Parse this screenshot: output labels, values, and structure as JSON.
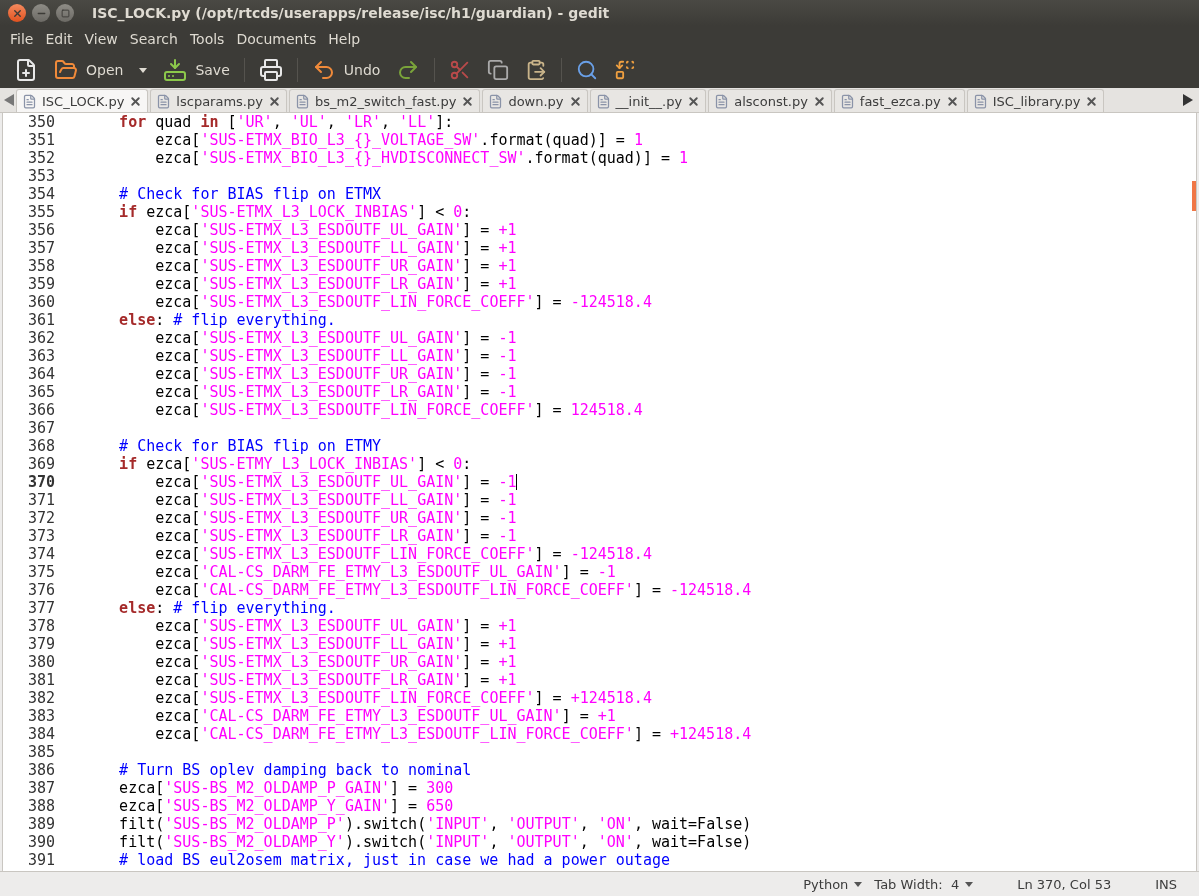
{
  "window": {
    "title": "ISC_LOCK.py (/opt/rtcds/userapps/release/isc/h1/guardian) - gedit"
  },
  "menu": [
    "File",
    "Edit",
    "View",
    "Search",
    "Tools",
    "Documents",
    "Help"
  ],
  "toolbar": {
    "open_label": "Open",
    "save_label": "Save",
    "undo_label": "Undo"
  },
  "tabs": [
    {
      "label": "ISC_LOCK.py",
      "selected": true
    },
    {
      "label": "lscparams.py",
      "selected": false
    },
    {
      "label": "bs_m2_switch_fast.py",
      "selected": false
    },
    {
      "label": "down.py",
      "selected": false
    },
    {
      "label": "__init__.py",
      "selected": false
    },
    {
      "label": "alsconst.py",
      "selected": false
    },
    {
      "label": "fast_ezca.py",
      "selected": false
    },
    {
      "label": "ISC_library.py",
      "selected": false
    }
  ],
  "editor": {
    "lines": [
      {
        "number": "350",
        "current": false,
        "kind": "block",
        "tokens": [
          {
            "kind": "keyword",
            "text": "for"
          },
          {
            "kind": "plain",
            "text": " quad "
          },
          {
            "kind": "keyword",
            "text": "in"
          },
          {
            "kind": "plain",
            "text": " ["
          },
          {
            "kind": "string",
            "text": "'UR'"
          },
          {
            "kind": "plain",
            "text": ", "
          },
          {
            "kind": "string",
            "text": "'UL'"
          },
          {
            "kind": "plain",
            "text": ", "
          },
          {
            "kind": "string",
            "text": "'LR'"
          },
          {
            "kind": "plain",
            "text": ", "
          },
          {
            "kind": "string",
            "text": "'LL'"
          },
          {
            "kind": "plain",
            "text": "]:"
          }
        ]
      },
      {
        "number": "351",
        "current": false,
        "kind": "nested",
        "tokens": [
          {
            "kind": "plain",
            "text": "ezca["
          },
          {
            "kind": "string",
            "text": "'SUS-ETMX_BIO_L3_{}_VOLTAGE_SW'"
          },
          {
            "kind": "plain",
            "text": ".format(quad)] = "
          },
          {
            "kind": "number",
            "text": "1"
          }
        ]
      },
      {
        "number": "352",
        "current": false,
        "kind": "nested",
        "tokens": [
          {
            "kind": "plain",
            "text": "ezca["
          },
          {
            "kind": "string",
            "text": "'SUS-ETMX_BIO_L3_{}_HVDISCONNECT_SW'"
          },
          {
            "kind": "plain",
            "text": ".format(quad)] = "
          },
          {
            "kind": "number",
            "text": "1"
          }
        ]
      },
      {
        "number": "353",
        "current": false
      },
      {
        "number": "354",
        "current": false,
        "kind": "block",
        "tokens": [
          {
            "kind": "comment",
            "text": "# Check for BIAS flip on ETMX"
          }
        ]
      },
      {
        "number": "355",
        "current": false,
        "kind": "block",
        "tokens": [
          {
            "kind": "keyword",
            "text": "if"
          },
          {
            "kind": "plain",
            "text": " ezca["
          },
          {
            "kind": "string",
            "text": "'SUS-ETMX_L3_LOCK_INBIAS'"
          },
          {
            "kind": "plain",
            "text": "] < "
          },
          {
            "kind": "number",
            "text": "0"
          },
          {
            "kind": "plain",
            "text": ":"
          }
        ]
      },
      {
        "number": "356",
        "current": false,
        "kind": "nested",
        "tokens": [
          {
            "kind": "plain",
            "text": "ezca["
          },
          {
            "kind": "string",
            "text": "'SUS-ETMX_L3_ESDOUTF_UL_GAIN'"
          },
          {
            "kind": "plain",
            "text": "] = "
          },
          {
            "kind": "number",
            "text": "+1"
          }
        ]
      },
      {
        "number": "357",
        "current": false,
        "kind": "nested",
        "tokens": [
          {
            "kind": "plain",
            "text": "ezca["
          },
          {
            "kind": "string",
            "text": "'SUS-ETMX_L3_ESDOUTF_LL_GAIN'"
          },
          {
            "kind": "plain",
            "text": "] = "
          },
          {
            "kind": "number",
            "text": "+1"
          }
        ]
      },
      {
        "number": "358",
        "current": false,
        "kind": "nested",
        "tokens": [
          {
            "kind": "plain",
            "text": "ezca["
          },
          {
            "kind": "string",
            "text": "'SUS-ETMX_L3_ESDOUTF_UR_GAIN'"
          },
          {
            "kind": "plain",
            "text": "] = "
          },
          {
            "kind": "number",
            "text": "+1"
          }
        ]
      },
      {
        "number": "359",
        "current": false,
        "kind": "nested",
        "tokens": [
          {
            "kind": "plain",
            "text": "ezca["
          },
          {
            "kind": "string",
            "text": "'SUS-ETMX_L3_ESDOUTF_LR_GAIN'"
          },
          {
            "kind": "plain",
            "text": "] = "
          },
          {
            "kind": "number",
            "text": "+1"
          }
        ]
      },
      {
        "number": "360",
        "current": false,
        "kind": "nested",
        "tokens": [
          {
            "kind": "plain",
            "text": "ezca["
          },
          {
            "kind": "string",
            "text": "'SUS-ETMX_L3_ESDOUTF_LIN_FORCE_COEFF'"
          },
          {
            "kind": "plain",
            "text": "] = "
          },
          {
            "kind": "number",
            "text": "-124518.4"
          }
        ]
      },
      {
        "number": "361",
        "current": false,
        "kind": "block",
        "tokens": [
          {
            "kind": "keyword",
            "text": "else"
          },
          {
            "kind": "plain",
            "text": ": "
          },
          {
            "kind": "comment",
            "text": "# flip everything."
          }
        ]
      },
      {
        "number": "362",
        "current": false,
        "kind": "nested",
        "tokens": [
          {
            "kind": "plain",
            "text": "ezca["
          },
          {
            "kind": "string",
            "text": "'SUS-ETMX_L3_ESDOUTF_UL_GAIN'"
          },
          {
            "kind": "plain",
            "text": "] = "
          },
          {
            "kind": "number",
            "text": "-1"
          }
        ]
      },
      {
        "number": "363",
        "current": false,
        "kind": "nested",
        "tokens": [
          {
            "kind": "plain",
            "text": "ezca["
          },
          {
            "kind": "string",
            "text": "'SUS-ETMX_L3_ESDOUTF_LL_GAIN'"
          },
          {
            "kind": "plain",
            "text": "] = "
          },
          {
            "kind": "number",
            "text": "-1"
          }
        ]
      },
      {
        "number": "364",
        "current": false,
        "kind": "nested",
        "tokens": [
          {
            "kind": "plain",
            "text": "ezca["
          },
          {
            "kind": "string",
            "text": "'SUS-ETMX_L3_ESDOUTF_UR_GAIN'"
          },
          {
            "kind": "plain",
            "text": "] = "
          },
          {
            "kind": "number",
            "text": "-1"
          }
        ]
      },
      {
        "number": "365",
        "current": false,
        "kind": "nested",
        "tokens": [
          {
            "kind": "plain",
            "text": "ezca["
          },
          {
            "kind": "string",
            "text": "'SUS-ETMX_L3_ESDOUTF_LR_GAIN'"
          },
          {
            "kind": "plain",
            "text": "] = "
          },
          {
            "kind": "number",
            "text": "-1"
          }
        ]
      },
      {
        "number": "366",
        "current": false,
        "kind": "nested",
        "tokens": [
          {
            "kind": "plain",
            "text": "ezca["
          },
          {
            "kind": "string",
            "text": "'SUS-ETMX_L3_ESDOUTF_LIN_FORCE_COEFF'"
          },
          {
            "kind": "plain",
            "text": "] = "
          },
          {
            "kind": "number",
            "text": "124518.4"
          }
        ]
      },
      {
        "number": "367",
        "current": false
      },
      {
        "number": "368",
        "current": false,
        "kind": "block",
        "tokens": [
          {
            "kind": "comment",
            "text": "# Check for BIAS flip on ETMY"
          }
        ]
      },
      {
        "number": "369",
        "current": false,
        "kind": "block",
        "tokens": [
          {
            "kind": "keyword",
            "text": "if"
          },
          {
            "kind": "plain",
            "text": " ezca["
          },
          {
            "kind": "string",
            "text": "'SUS-ETMY_L3_LOCK_INBIAS'"
          },
          {
            "kind": "plain",
            "text": "] < "
          },
          {
            "kind": "number",
            "text": "0"
          },
          {
            "kind": "plain",
            "text": ":"
          }
        ]
      },
      {
        "number": "370",
        "current": true,
        "kind": "nested",
        "tokens": [
          {
            "kind": "plain",
            "text": "ezca["
          },
          {
            "kind": "string",
            "text": "'SUS-ETMX_L3_ESDOUTF_UL_GAIN'"
          },
          {
            "kind": "plain",
            "text": "] = "
          },
          {
            "kind": "number",
            "text": "-1"
          }
        ]
      },
      {
        "number": "371",
        "current": false,
        "kind": "nested",
        "tokens": [
          {
            "kind": "plain",
            "text": "ezca["
          },
          {
            "kind": "string",
            "text": "'SUS-ETMX_L3_ESDOUTF_LL_GAIN'"
          },
          {
            "kind": "plain",
            "text": "] = "
          },
          {
            "kind": "number",
            "text": "-1"
          }
        ]
      },
      {
        "number": "372",
        "current": false,
        "kind": "nested",
        "tokens": [
          {
            "kind": "plain",
            "text": "ezca["
          },
          {
            "kind": "string",
            "text": "'SUS-ETMX_L3_ESDOUTF_UR_GAIN'"
          },
          {
            "kind": "plain",
            "text": "] = "
          },
          {
            "kind": "number",
            "text": "-1"
          }
        ]
      },
      {
        "number": "373",
        "current": false,
        "kind": "nested",
        "tokens": [
          {
            "kind": "plain",
            "text": "ezca["
          },
          {
            "kind": "string",
            "text": "'SUS-ETMX_L3_ESDOUTF_LR_GAIN'"
          },
          {
            "kind": "plain",
            "text": "] = "
          },
          {
            "kind": "number",
            "text": "-1"
          }
        ]
      },
      {
        "number": "374",
        "current": false,
        "kind": "nested",
        "tokens": [
          {
            "kind": "plain",
            "text": "ezca["
          },
          {
            "kind": "string",
            "text": "'SUS-ETMX_L3_ESDOUTF_LIN_FORCE_COEFF'"
          },
          {
            "kind": "plain",
            "text": "] = "
          },
          {
            "kind": "number",
            "text": "-124518.4"
          }
        ]
      },
      {
        "number": "375",
        "current": false,
        "kind": "nested",
        "tokens": [
          {
            "kind": "plain",
            "text": "ezca["
          },
          {
            "kind": "string",
            "text": "'CAL-CS_DARM_FE_ETMY_L3_ESDOUTF_UL_GAIN'"
          },
          {
            "kind": "plain",
            "text": "] = "
          },
          {
            "kind": "number",
            "text": "-1"
          }
        ]
      },
      {
        "number": "376",
        "current": false,
        "kind": "nested",
        "tokens": [
          {
            "kind": "plain",
            "text": "ezca["
          },
          {
            "kind": "string",
            "text": "'CAL-CS_DARM_FE_ETMY_L3_ESDOUTF_LIN_FORCE_COEFF'"
          },
          {
            "kind": "plain",
            "text": "] = "
          },
          {
            "kind": "number",
            "text": "-124518.4"
          }
        ]
      },
      {
        "number": "377",
        "current": false,
        "kind": "block",
        "tokens": [
          {
            "kind": "keyword",
            "text": "else"
          },
          {
            "kind": "plain",
            "text": ": "
          },
          {
            "kind": "comment",
            "text": "# flip everything."
          }
        ]
      },
      {
        "number": "378",
        "current": false,
        "kind": "nested",
        "tokens": [
          {
            "kind": "plain",
            "text": "ezca["
          },
          {
            "kind": "string",
            "text": "'SUS-ETMX_L3_ESDOUTF_UL_GAIN'"
          },
          {
            "kind": "plain",
            "text": "] = "
          },
          {
            "kind": "number",
            "text": "+1"
          }
        ]
      },
      {
        "number": "379",
        "current": false,
        "kind": "nested",
        "tokens": [
          {
            "kind": "plain",
            "text": "ezca["
          },
          {
            "kind": "string",
            "text": "'SUS-ETMX_L3_ESDOUTF_LL_GAIN'"
          },
          {
            "kind": "plain",
            "text": "] = "
          },
          {
            "kind": "number",
            "text": "+1"
          }
        ]
      },
      {
        "number": "380",
        "current": false,
        "kind": "nested",
        "tokens": [
          {
            "kind": "plain",
            "text": "ezca["
          },
          {
            "kind": "string",
            "text": "'SUS-ETMX_L3_ESDOUTF_UR_GAIN'"
          },
          {
            "kind": "plain",
            "text": "] = "
          },
          {
            "kind": "number",
            "text": "+1"
          }
        ]
      },
      {
        "number": "381",
        "current": false,
        "kind": "nested",
        "tokens": [
          {
            "kind": "plain",
            "text": "ezca["
          },
          {
            "kind": "string",
            "text": "'SUS-ETMX_L3_ESDOUTF_LR_GAIN'"
          },
          {
            "kind": "plain",
            "text": "] = "
          },
          {
            "kind": "number",
            "text": "+1"
          }
        ]
      },
      {
        "number": "382",
        "current": false,
        "kind": "nested",
        "tokens": [
          {
            "kind": "plain",
            "text": "ezca["
          },
          {
            "kind": "string",
            "text": "'SUS-ETMX_L3_ESDOUTF_LIN_FORCE_COEFF'"
          },
          {
            "kind": "plain",
            "text": "] = "
          },
          {
            "kind": "number",
            "text": "+124518.4"
          }
        ]
      },
      {
        "number": "383",
        "current": false,
        "kind": "nested",
        "tokens": [
          {
            "kind": "plain",
            "text": "ezca["
          },
          {
            "kind": "string",
            "text": "'CAL-CS_DARM_FE_ETMY_L3_ESDOUTF_UL_GAIN'"
          },
          {
            "kind": "plain",
            "text": "] = "
          },
          {
            "kind": "number",
            "text": "+1"
          }
        ]
      },
      {
        "number": "384",
        "current": false,
        "kind": "nested",
        "tokens": [
          {
            "kind": "plain",
            "text": "ezca["
          },
          {
            "kind": "string",
            "text": "'CAL-CS_DARM_FE_ETMY_L3_ESDOUTF_LIN_FORCE_COEFF'"
          },
          {
            "kind": "plain",
            "text": "] = "
          },
          {
            "kind": "number",
            "text": "+124518.4"
          }
        ]
      },
      {
        "number": "385",
        "current": false
      },
      {
        "number": "386",
        "current": false,
        "kind": "block",
        "tokens": [
          {
            "kind": "comment",
            "text": "# Turn BS oplev damping back to nominal"
          }
        ]
      },
      {
        "number": "387",
        "current": false,
        "kind": "block",
        "tokens": [
          {
            "kind": "plain",
            "text": "ezca["
          },
          {
            "kind": "string",
            "text": "'SUS-BS_M2_OLDAMP_P_GAIN'"
          },
          {
            "kind": "plain",
            "text": "] = "
          },
          {
            "kind": "number",
            "text": "300"
          }
        ]
      },
      {
        "number": "388",
        "current": false,
        "kind": "block",
        "tokens": [
          {
            "kind": "plain",
            "text": "ezca["
          },
          {
            "kind": "string",
            "text": "'SUS-BS_M2_OLDAMP_Y_GAIN'"
          },
          {
            "kind": "plain",
            "text": "] = "
          },
          {
            "kind": "number",
            "text": "650"
          }
        ]
      },
      {
        "number": "389",
        "current": false,
        "kind": "block",
        "tokens": [
          {
            "kind": "plain",
            "text": "filt("
          },
          {
            "kind": "string",
            "text": "'SUS-BS_M2_OLDAMP_P'"
          },
          {
            "kind": "plain",
            "text": ").switch("
          },
          {
            "kind": "string",
            "text": "'INPUT'"
          },
          {
            "kind": "plain",
            "text": ", "
          },
          {
            "kind": "string",
            "text": "'OUTPUT'"
          },
          {
            "kind": "plain",
            "text": ", "
          },
          {
            "kind": "string",
            "text": "'ON'"
          },
          {
            "kind": "plain",
            "text": ", wait=False)"
          }
        ]
      },
      {
        "number": "390",
        "current": false,
        "kind": "block",
        "tokens": [
          {
            "kind": "plain",
            "text": "filt("
          },
          {
            "kind": "string",
            "text": "'SUS-BS_M2_OLDAMP_Y'"
          },
          {
            "kind": "plain",
            "text": ").switch("
          },
          {
            "kind": "string",
            "text": "'INPUT'"
          },
          {
            "kind": "plain",
            "text": ", "
          },
          {
            "kind": "string",
            "text": "'OUTPUT'"
          },
          {
            "kind": "plain",
            "text": ", "
          },
          {
            "kind": "string",
            "text": "'ON'"
          },
          {
            "kind": "plain",
            "text": ", wait=False)"
          }
        ]
      },
      {
        "number": "391",
        "current": false,
        "kind": "block",
        "tokens": [
          {
            "kind": "comment",
            "text": "# load BS eul2osem matrix, just in case we had a power outage"
          }
        ]
      }
    ]
  },
  "status_bar": {
    "language": "Python",
    "tab_width": "Tab Width:  4",
    "position": "Ln 370, Col 53",
    "mode": "INS"
  }
}
